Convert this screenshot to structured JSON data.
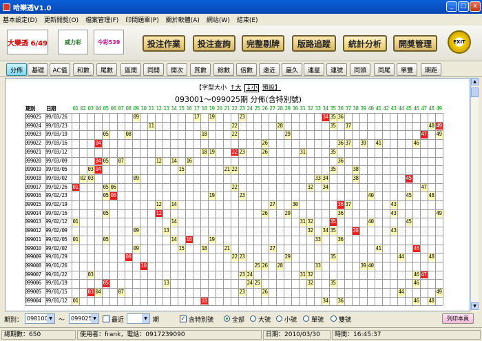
{
  "window": {
    "title": "哈樂透V1.0",
    "min": "_",
    "max": "□",
    "close": "x"
  },
  "menu": [
    "基本設定(D)",
    "更新開獎(O)",
    "檔案管理(F)",
    "印問題單(P)",
    "關於軟體(A)",
    "網站(W)",
    "結束(E)"
  ],
  "logos": [
    "大樂透 6/49",
    "威力彩",
    "今彩539"
  ],
  "toolbar": [
    "投注作業",
    "投注查詢",
    "完整剔牌",
    "版路追蹤",
    "統計分析",
    "開獎管理"
  ],
  "exit_label": "EXIT",
  "subtabs": [
    "分佈",
    "基礎",
    "AC值",
    "和數",
    "尾數",
    "區間",
    "同開",
    "開次",
    "質數",
    "餘數",
    "倍數",
    "遠近",
    "最久",
    "連星",
    "連號",
    "同頭",
    "同尾",
    "單雙",
    "期距"
  ],
  "font_control": {
    "label": "【字型大小",
    "up": "↑大",
    "down": "↓小",
    "preset": "預設】"
  },
  "period_title": "093001～099025期 分佈(含特別號)",
  "grid": {
    "headers": [
      "期別",
      "日期"
    ],
    "numbers": [
      "01",
      "02",
      "03",
      "04",
      "05",
      "06",
      "07",
      "08",
      "09",
      "10",
      "11",
      "12",
      "13",
      "14",
      "15",
      "16",
      "17",
      "18",
      "19",
      "20",
      "21",
      "22",
      "23",
      "24",
      "25",
      "26",
      "27",
      "28",
      "29",
      "30",
      "31",
      "32",
      "33",
      "34",
      "35",
      "36",
      "37",
      "38",
      "39",
      "40",
      "41",
      "42",
      "43",
      "44",
      "45",
      "46",
      "47",
      "48",
      "49"
    ],
    "rows": [
      {
        "p": "099025",
        "d": "99/03/26",
        "n": [
          9,
          17,
          19,
          23,
          34,
          35,
          36
        ],
        "r": [
          34
        ]
      },
      {
        "p": "099024",
        "d": "99/03/23",
        "n": [
          11,
          22,
          28,
          35,
          37,
          48,
          49
        ],
        "r": [
          49
        ]
      },
      {
        "p": "099023",
        "d": "99/03/19",
        "n": [
          5,
          8,
          18,
          22,
          29,
          47,
          49
        ],
        "r": [
          47
        ]
      },
      {
        "p": "099022",
        "d": "99/03/16",
        "n": [
          4,
          26,
          36,
          37,
          39,
          41,
          46
        ],
        "r": [
          4
        ]
      },
      {
        "p": "099021",
        "d": "99/03/12",
        "n": [
          18,
          19,
          22,
          23,
          26,
          31,
          35
        ],
        "r": [
          22
        ]
      },
      {
        "p": "099020",
        "d": "99/03/09",
        "n": [
          4,
          5,
          7,
          12,
          14,
          16,
          36
        ],
        "r": [
          4
        ]
      },
      {
        "p": "099019",
        "d": "99/03/05",
        "n": [
          3,
          4,
          15,
          21,
          22,
          35,
          38
        ],
        "r": [
          4
        ]
      },
      {
        "p": "099018",
        "d": "99/03/02",
        "n": [
          2,
          3,
          9,
          33,
          34,
          38,
          45
        ],
        "r": [
          45
        ]
      },
      {
        "p": "099017",
        "d": "99/02/26",
        "n": [
          1,
          5,
          6,
          22,
          32,
          34,
          47
        ],
        "r": [
          1
        ]
      },
      {
        "p": "099016",
        "d": "99/02/23",
        "n": [
          5,
          6,
          19,
          23,
          40,
          45,
          48
        ],
        "r": [
          6
        ]
      },
      {
        "p": "099015",
        "d": "99/02/19",
        "n": [
          12,
          14,
          27,
          30,
          36,
          37,
          43
        ],
        "r": [
          36
        ]
      },
      {
        "p": "099014",
        "d": "99/02/16",
        "n": [
          5,
          12,
          26,
          29,
          36,
          43,
          49
        ],
        "r": [
          12
        ]
      },
      {
        "p": "099013",
        "d": "99/02/12",
        "n": [
          1,
          14,
          31,
          32,
          35,
          40,
          45
        ],
        "r": [
          35
        ]
      },
      {
        "p": "099012",
        "d": "99/02/09",
        "n": [
          9,
          13,
          32,
          34,
          35,
          38,
          43
        ],
        "r": [
          38
        ]
      },
      {
        "p": "099011",
        "d": "99/02/05",
        "n": [
          1,
          5,
          14,
          16,
          19,
          33,
          36
        ],
        "r": [
          16
        ]
      },
      {
        "p": "099010",
        "d": "99/02/02",
        "n": [
          9,
          15,
          18,
          21,
          27,
          41,
          46
        ],
        "r": [
          46
        ]
      },
      {
        "p": "099009",
        "d": "99/01/29",
        "n": [
          8,
          22,
          23,
          29,
          35,
          44,
          48
        ],
        "r": [
          8
        ]
      },
      {
        "p": "099008",
        "d": "99/01/26",
        "n": [
          10,
          25,
          26,
          28,
          33,
          39,
          40
        ],
        "r": [
          10
        ]
      },
      {
        "p": "099007",
        "d": "99/01/22",
        "n": [
          3,
          23,
          24,
          31,
          32,
          46,
          47
        ],
        "r": [
          47
        ]
      },
      {
        "p": "099006",
        "d": "99/01/19",
        "n": [
          5,
          13,
          24,
          25,
          32,
          35,
          46
        ],
        "r": [
          5
        ]
      },
      {
        "p": "099005",
        "d": "99/01/15",
        "n": [
          3,
          4,
          7,
          23,
          26,
          44,
          49
        ],
        "r": [
          3
        ]
      },
      {
        "p": "099004",
        "d": "99/01/12",
        "n": [
          1,
          18,
          34,
          36,
          46,
          48
        ],
        "r": [
          18
        ]
      }
    ]
  },
  "filter": {
    "period_label": "期別：",
    "from": "098100",
    "tilde": "～",
    "to": "099025",
    "recent_label": "最近",
    "period_unit": "期",
    "special_label": "含特別號",
    "special_checked": true,
    "radios": [
      "全部",
      "大號",
      "小號",
      "單號",
      "雙號"
    ],
    "selected_radio": 0,
    "print_label": "列印本頁"
  },
  "status": {
    "total": "總期數：650",
    "user": "使用者：frank，電話：0917239090",
    "date": "日期：2010/03/30",
    "time": "時間：16:45:37"
  },
  "colors": {
    "header_green": "#0a9a12",
    "normal_cell": "#ffffb8",
    "special_cell": "#e82020",
    "active_tab": "#7fd5f2"
  }
}
